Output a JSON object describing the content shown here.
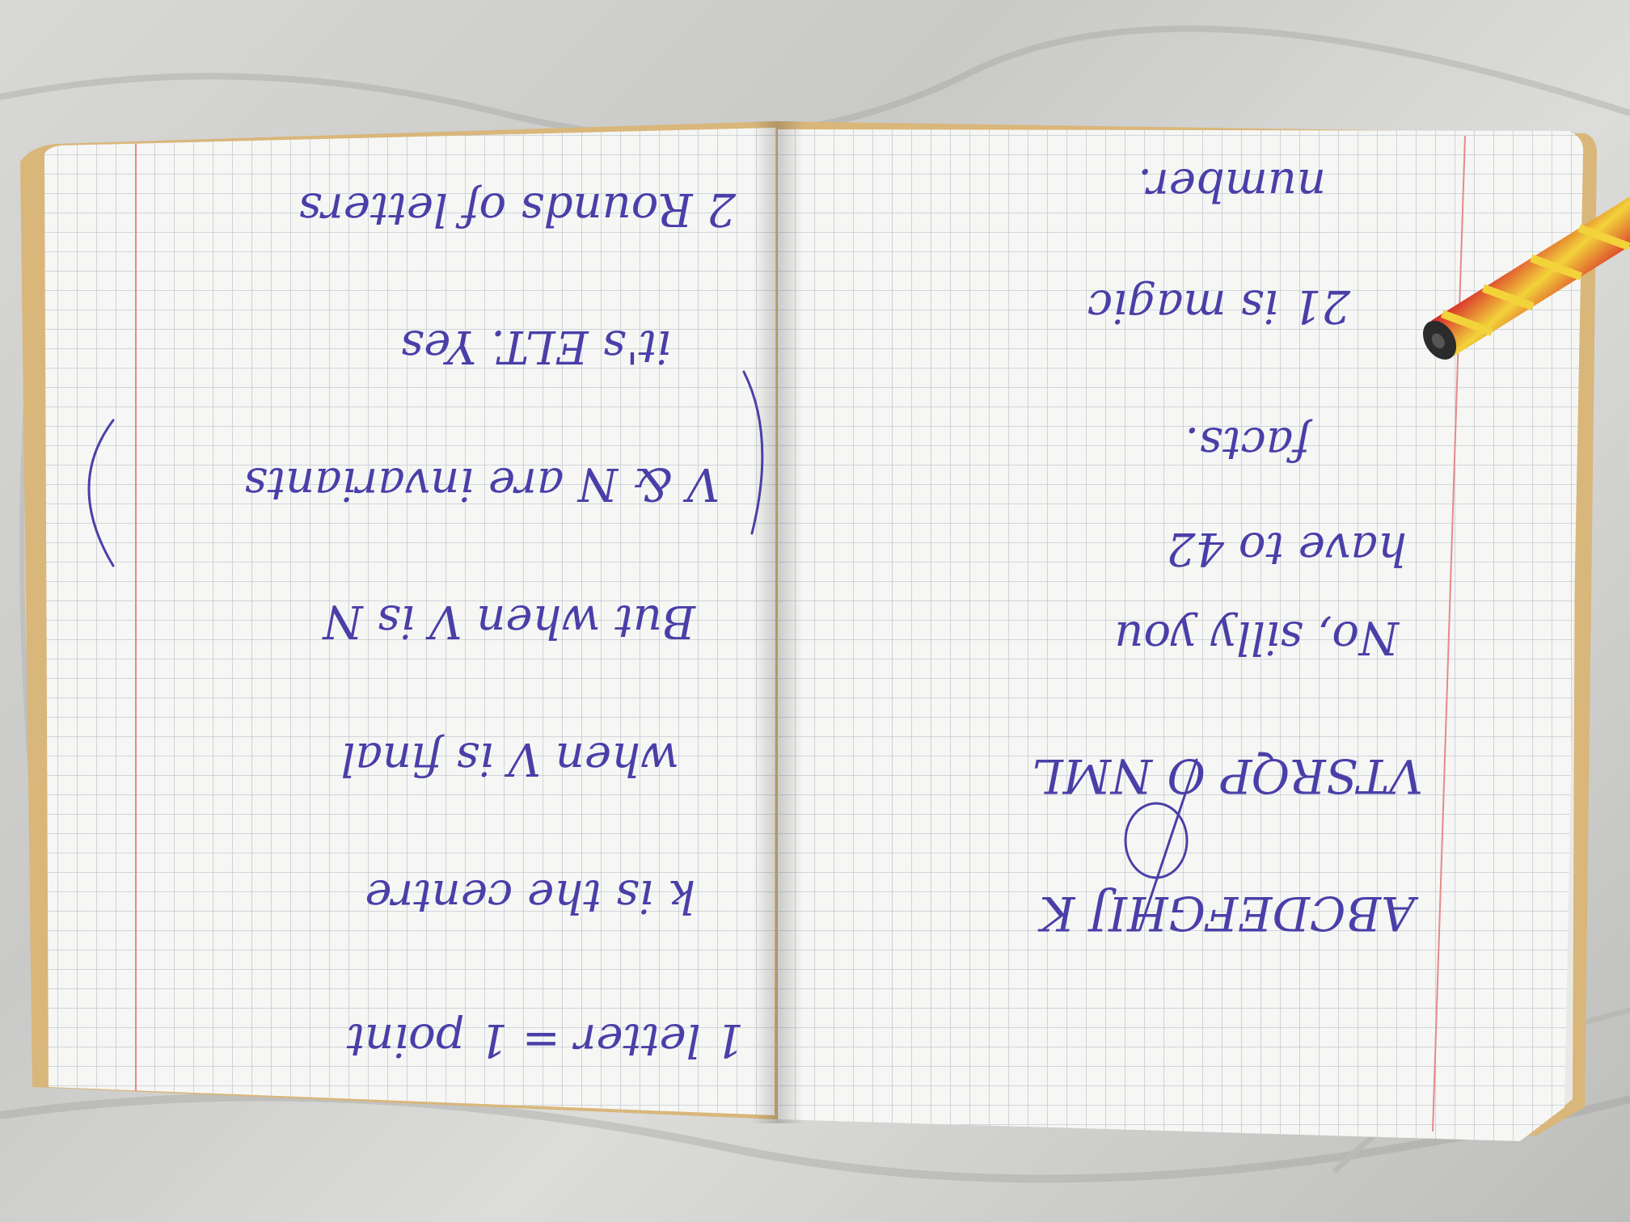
{
  "notebook": {
    "left_page": {
      "lines_upside_down": [
        "2 Rounds of letters",
        "it's ELT. Yes",
        "V & N are invariants",
        "But when V is N",
        "when V is final",
        "k is the centre",
        "1 letter = 1 point"
      ]
    },
    "right_page": {
      "lines_upside_down": [
        "number.",
        "21 is magic",
        "facts.",
        "have to 42",
        "No, silly you",
        "VTSRQP O NML",
        "ABCDEFGHIJ K"
      ]
    },
    "colors": {
      "ink": "#4a3fa8",
      "paper": "#f6f6f4",
      "grid": "#b9c3cc",
      "margin_line": "#e58a8a",
      "cover": "#d9b67a",
      "pencil_red": "#d8232a",
      "pencil_yellow": "#f2d33a"
    }
  }
}
